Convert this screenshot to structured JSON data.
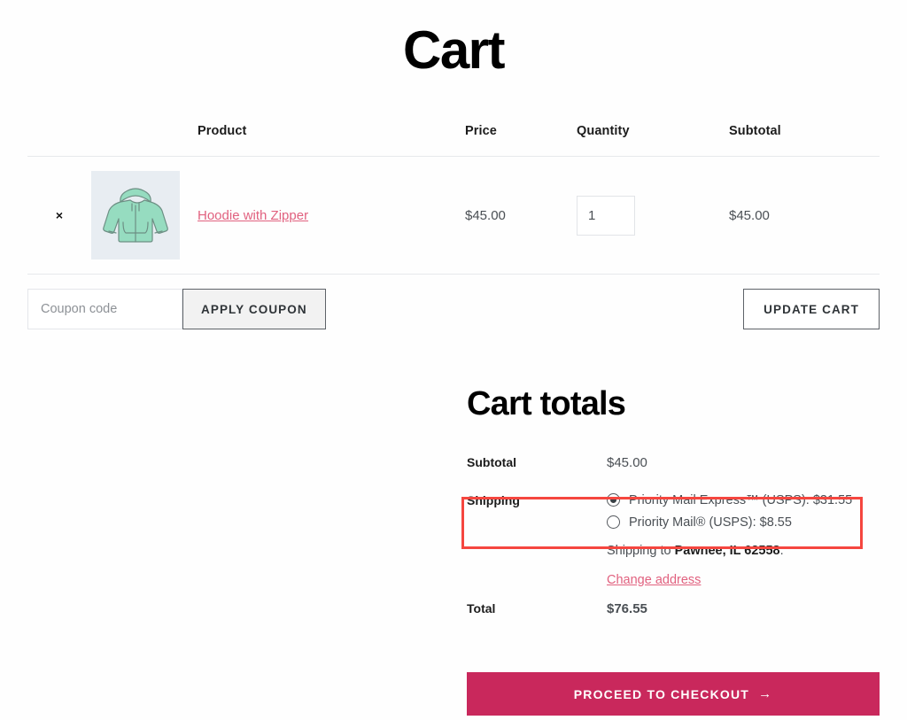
{
  "page": {
    "title": "Cart"
  },
  "cart_table": {
    "headers": {
      "remove": "",
      "thumbnail": "",
      "product": "Product",
      "price": "Price",
      "quantity": "Quantity",
      "subtotal": "Subtotal"
    },
    "rows": [
      {
        "remove_label": "×",
        "thumbnail_alt": "hoodie-with-zipper-thumbnail",
        "product_name": "Hoodie with Zipper",
        "price": "$45.00",
        "quantity": "1",
        "subtotal": "$45.00"
      }
    ]
  },
  "actions": {
    "coupon_placeholder": "Coupon code",
    "coupon_value": "",
    "apply_coupon_label": "APPLY COUPON",
    "update_cart_label": "UPDATE CART"
  },
  "totals": {
    "title": "Cart totals",
    "subtotal_label": "Subtotal",
    "subtotal_value": "$45.00",
    "shipping_label": "Shipping",
    "shipping_options": [
      {
        "label": "Priority Mail Express™ (USPS): $31.55",
        "selected": true
      },
      {
        "label": "Priority Mail® (USPS): $8.55",
        "selected": false
      }
    ],
    "shipping_to_prefix": "Shipping to ",
    "shipping_to_address": "Pawnee, IL 62558",
    "shipping_to_suffix": ".",
    "change_address_label": "Change address",
    "total_label": "Total",
    "total_value": "$76.55"
  },
  "checkout": {
    "label": "PROCEED TO CHECKOUT",
    "arrow": "→"
  },
  "colors": {
    "link": "#e1617f",
    "checkout_button": "#c9285c",
    "highlight_border": "#f5463f",
    "thumb_background": "#e8edf2",
    "product_mint": "#8fd8bb"
  }
}
